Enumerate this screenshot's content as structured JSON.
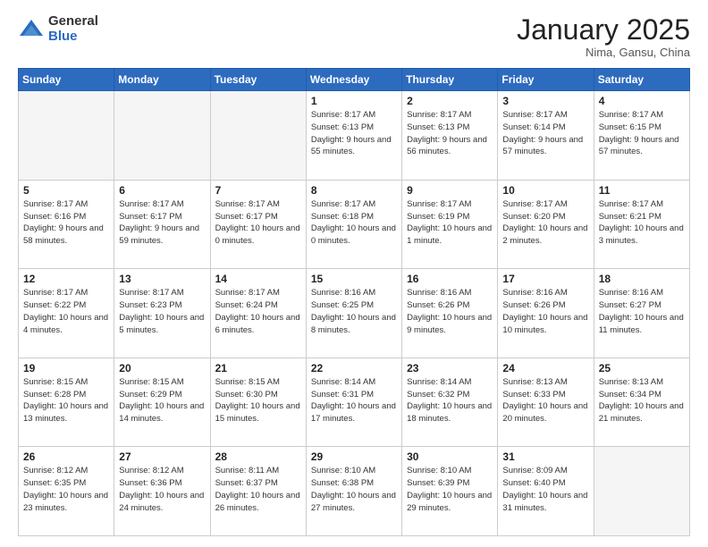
{
  "logo": {
    "general": "General",
    "blue": "Blue"
  },
  "header": {
    "month": "January 2025",
    "location": "Nima, Gansu, China"
  },
  "weekdays": [
    "Sunday",
    "Monday",
    "Tuesday",
    "Wednesday",
    "Thursday",
    "Friday",
    "Saturday"
  ],
  "weeks": [
    [
      {
        "day": "",
        "info": ""
      },
      {
        "day": "",
        "info": ""
      },
      {
        "day": "",
        "info": ""
      },
      {
        "day": "1",
        "info": "Sunrise: 8:17 AM\nSunset: 6:13 PM\nDaylight: 9 hours\nand 55 minutes."
      },
      {
        "day": "2",
        "info": "Sunrise: 8:17 AM\nSunset: 6:13 PM\nDaylight: 9 hours\nand 56 minutes."
      },
      {
        "day": "3",
        "info": "Sunrise: 8:17 AM\nSunset: 6:14 PM\nDaylight: 9 hours\nand 57 minutes."
      },
      {
        "day": "4",
        "info": "Sunrise: 8:17 AM\nSunset: 6:15 PM\nDaylight: 9 hours\nand 57 minutes."
      }
    ],
    [
      {
        "day": "5",
        "info": "Sunrise: 8:17 AM\nSunset: 6:16 PM\nDaylight: 9 hours\nand 58 minutes."
      },
      {
        "day": "6",
        "info": "Sunrise: 8:17 AM\nSunset: 6:17 PM\nDaylight: 9 hours\nand 59 minutes."
      },
      {
        "day": "7",
        "info": "Sunrise: 8:17 AM\nSunset: 6:17 PM\nDaylight: 10 hours\nand 0 minutes."
      },
      {
        "day": "8",
        "info": "Sunrise: 8:17 AM\nSunset: 6:18 PM\nDaylight: 10 hours\nand 0 minutes."
      },
      {
        "day": "9",
        "info": "Sunrise: 8:17 AM\nSunset: 6:19 PM\nDaylight: 10 hours\nand 1 minute."
      },
      {
        "day": "10",
        "info": "Sunrise: 8:17 AM\nSunset: 6:20 PM\nDaylight: 10 hours\nand 2 minutes."
      },
      {
        "day": "11",
        "info": "Sunrise: 8:17 AM\nSunset: 6:21 PM\nDaylight: 10 hours\nand 3 minutes."
      }
    ],
    [
      {
        "day": "12",
        "info": "Sunrise: 8:17 AM\nSunset: 6:22 PM\nDaylight: 10 hours\nand 4 minutes."
      },
      {
        "day": "13",
        "info": "Sunrise: 8:17 AM\nSunset: 6:23 PM\nDaylight: 10 hours\nand 5 minutes."
      },
      {
        "day": "14",
        "info": "Sunrise: 8:17 AM\nSunset: 6:24 PM\nDaylight: 10 hours\nand 6 minutes."
      },
      {
        "day": "15",
        "info": "Sunrise: 8:16 AM\nSunset: 6:25 PM\nDaylight: 10 hours\nand 8 minutes."
      },
      {
        "day": "16",
        "info": "Sunrise: 8:16 AM\nSunset: 6:26 PM\nDaylight: 10 hours\nand 9 minutes."
      },
      {
        "day": "17",
        "info": "Sunrise: 8:16 AM\nSunset: 6:26 PM\nDaylight: 10 hours\nand 10 minutes."
      },
      {
        "day": "18",
        "info": "Sunrise: 8:16 AM\nSunset: 6:27 PM\nDaylight: 10 hours\nand 11 minutes."
      }
    ],
    [
      {
        "day": "19",
        "info": "Sunrise: 8:15 AM\nSunset: 6:28 PM\nDaylight: 10 hours\nand 13 minutes."
      },
      {
        "day": "20",
        "info": "Sunrise: 8:15 AM\nSunset: 6:29 PM\nDaylight: 10 hours\nand 14 minutes."
      },
      {
        "day": "21",
        "info": "Sunrise: 8:15 AM\nSunset: 6:30 PM\nDaylight: 10 hours\nand 15 minutes."
      },
      {
        "day": "22",
        "info": "Sunrise: 8:14 AM\nSunset: 6:31 PM\nDaylight: 10 hours\nand 17 minutes."
      },
      {
        "day": "23",
        "info": "Sunrise: 8:14 AM\nSunset: 6:32 PM\nDaylight: 10 hours\nand 18 minutes."
      },
      {
        "day": "24",
        "info": "Sunrise: 8:13 AM\nSunset: 6:33 PM\nDaylight: 10 hours\nand 20 minutes."
      },
      {
        "day": "25",
        "info": "Sunrise: 8:13 AM\nSunset: 6:34 PM\nDaylight: 10 hours\nand 21 minutes."
      }
    ],
    [
      {
        "day": "26",
        "info": "Sunrise: 8:12 AM\nSunset: 6:35 PM\nDaylight: 10 hours\nand 23 minutes."
      },
      {
        "day": "27",
        "info": "Sunrise: 8:12 AM\nSunset: 6:36 PM\nDaylight: 10 hours\nand 24 minutes."
      },
      {
        "day": "28",
        "info": "Sunrise: 8:11 AM\nSunset: 6:37 PM\nDaylight: 10 hours\nand 26 minutes."
      },
      {
        "day": "29",
        "info": "Sunrise: 8:10 AM\nSunset: 6:38 PM\nDaylight: 10 hours\nand 27 minutes."
      },
      {
        "day": "30",
        "info": "Sunrise: 8:10 AM\nSunset: 6:39 PM\nDaylight: 10 hours\nand 29 minutes."
      },
      {
        "day": "31",
        "info": "Sunrise: 8:09 AM\nSunset: 6:40 PM\nDaylight: 10 hours\nand 31 minutes."
      },
      {
        "day": "",
        "info": ""
      }
    ]
  ]
}
